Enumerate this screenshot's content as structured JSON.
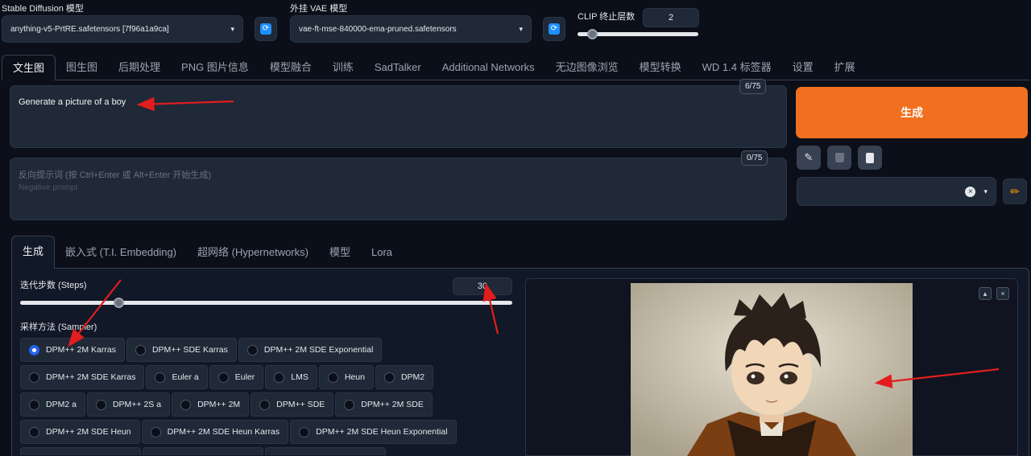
{
  "top": {
    "sd_model_label": "Stable Diffusion 模型",
    "sd_model_value": "anything-v5-PrtRE.safetensors [7f96a1a9ca]",
    "vae_label": "外挂 VAE 模型",
    "vae_value": "vae-ft-mse-840000-ema-pruned.safetensors",
    "clip_label": "CLIP 终止层数",
    "clip_value": "2",
    "clip_slider_fraction": 0.12
  },
  "main_tabs": [
    "文生图",
    "图生图",
    "后期处理",
    "PNG 图片信息",
    "模型融合",
    "训练",
    "SadTalker",
    "Additional Networks",
    "无边图像浏览",
    "模型转换",
    "WD 1.4 标签器",
    "设置",
    "扩展"
  ],
  "prompt": {
    "value": "Generate a picture of a boy",
    "counter": "6/75"
  },
  "negative_prompt": {
    "placeholder_line1": "反向提示词 (按 Ctrl+Enter 或 Alt+Enter 开始生成)",
    "placeholder_line2": "Negative prompt",
    "counter": "0/75"
  },
  "generate": {
    "label": "生成"
  },
  "tools": {
    "icons": [
      "pencil-icon",
      "trash-icon",
      "clipboard-icon"
    ],
    "style_clear": "×",
    "style_caret": "▾"
  },
  "sub_tabs": [
    "生成",
    "嵌入式 (T.I. Embedding)",
    "超网络 (Hypernetworks)",
    "模型",
    "Lora"
  ],
  "steps": {
    "label": "迭代步数 (Steps)",
    "value": "30",
    "slider_fraction": 0.2
  },
  "sampler": {
    "label": "采样方法 (Sampler)",
    "rows": [
      [
        "DPM++ 2M Karras",
        "DPM++ SDE Karras",
        "DPM++ 2M SDE Exponential"
      ],
      [
        "DPM++ 2M SDE Karras",
        "Euler a",
        "Euler",
        "LMS",
        "Heun",
        "DPM2"
      ],
      [
        "DPM2 a",
        "DPM++ 2S a",
        "DPM++ 2M",
        "DPM++ SDE",
        "DPM++ 2M SDE"
      ],
      [
        "DPM++ 2M SDE Heun",
        "DPM++ 2M SDE Heun Karras",
        "DPM++ 2M SDE Heun Exponential"
      ]
    ],
    "selected": "DPM++ 2M Karras"
  },
  "output": {
    "buttons": [
      "▴",
      "×"
    ]
  },
  "colors": {
    "bg": "#0b0f19",
    "accent": "#f0701f",
    "annotation_arrow": "#e11d1d"
  }
}
